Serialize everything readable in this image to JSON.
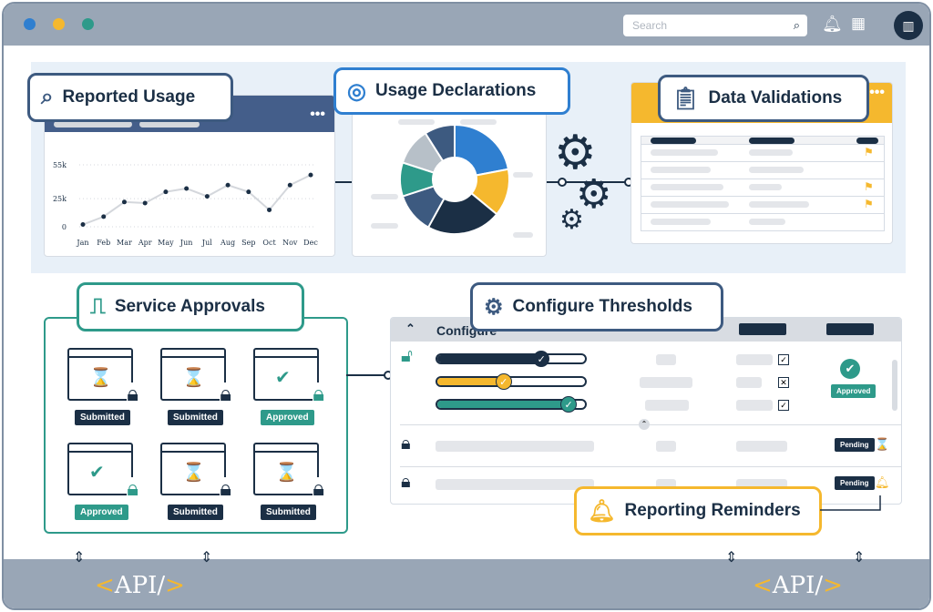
{
  "topbar": {
    "search_placeholder": "Search",
    "dots": [
      "#2f7fd0",
      "#f5b82e",
      "#2e9a8a"
    ]
  },
  "labels": {
    "reported_usage": "Reported Usage",
    "usage_declarations": "Usage Declarations",
    "data_validations": "Data Validations",
    "service_approvals": "Service Approvals",
    "configure_thresholds": "Configure Thresholds",
    "reporting_reminders": "Reporting Reminders",
    "configure_header": "Configure"
  },
  "chart_data": {
    "type": "line",
    "categories": [
      "Jan",
      "Feb",
      "Mar",
      "Apr",
      "May",
      "Jun",
      "Jul",
      "Aug",
      "Sep",
      "Oct",
      "Nov",
      "Dec"
    ],
    "values": [
      2000,
      9000,
      22000,
      21000,
      31000,
      34000,
      27000,
      37000,
      31000,
      15000,
      37000,
      46000
    ],
    "yticks": [
      "0",
      "25k",
      "55k"
    ],
    "ylim": [
      0,
      55000
    ],
    "grid": true
  },
  "donut": {
    "slices": [
      {
        "value": 22,
        "color": "#2f7fd0"
      },
      {
        "value": 14,
        "color": "#f5b82e"
      },
      {
        "value": 22,
        "color": "#1b2f45"
      },
      {
        "value": 12,
        "color": "#3d5a80"
      },
      {
        "value": 10,
        "color": "#2e9a8a"
      },
      {
        "value": 11,
        "color": "#b7c0c8"
      },
      {
        "value": 9,
        "color": "#3d5a80"
      }
    ]
  },
  "approvals": [
    {
      "status": "Submitted",
      "state": "pending"
    },
    {
      "status": "Submitted",
      "state": "pending"
    },
    {
      "status": "Approved",
      "state": "approved"
    },
    {
      "status": "Approved",
      "state": "approved"
    },
    {
      "status": "Submitted",
      "state": "pending"
    },
    {
      "status": "Submitted",
      "state": "pending"
    }
  ],
  "thresholds": {
    "sliders": [
      {
        "level": 0.7,
        "color": "#1b2f45"
      },
      {
        "level": 0.45,
        "color": "#f5b82e"
      },
      {
        "level": 0.88,
        "color": "#2e9a8a"
      }
    ],
    "checks": [
      "✓",
      "✕",
      "✓"
    ],
    "row1_status": "Approved",
    "row2_status": "Pending",
    "row3_status": "Pending"
  },
  "api_label": "API/",
  "colors": {
    "navy": "#1b2f45",
    "teal": "#2e9a8a",
    "yellow": "#f5b82e",
    "blue": "#2f7fd0"
  }
}
